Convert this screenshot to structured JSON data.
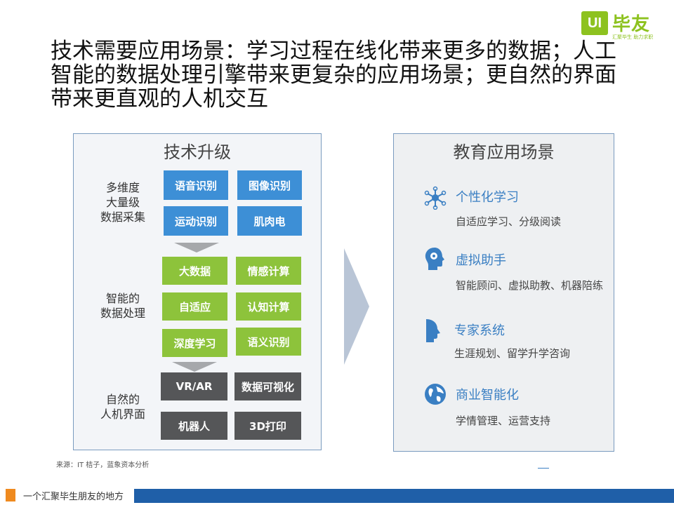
{
  "logo": {
    "mark": "UI",
    "brand": "毕友",
    "slogan": "汇聚毕生  助力求职"
  },
  "title": "技术需要应用场景：学习过程在线化带来更多的数据；人工智能的数据处理引擎带来更复杂的应用场景；更自然的界面带来更直观的人机交互",
  "left_panel": {
    "title": "技术升级",
    "groups": [
      {
        "label": "多维度\n大量级\n数据采集",
        "items": [
          "语音识别",
          "图像识别",
          "运动识别",
          "肌肉电"
        ]
      },
      {
        "label": "智能的\n数据处理",
        "items": [
          "大数据",
          "情感计算",
          "自适应",
          "认知计算",
          "深度学习",
          "语义识别"
        ]
      },
      {
        "label": "自然的\n人机界面",
        "items": [
          "VR/AR",
          "数据可视化",
          "机器人",
          "3D打印"
        ]
      }
    ]
  },
  "right_panel": {
    "title": "教育应用场景",
    "items": [
      {
        "name": "个性化学习",
        "desc": "自适应学习、分级阅读",
        "icon": "network-nodes-icon"
      },
      {
        "name": "虚拟助手",
        "desc": "智能顾问、虚拟助教、机器陪练",
        "icon": "head-gears-icon"
      },
      {
        "name": "专家系统",
        "desc": "生涯规划、留学升学咨询",
        "icon": "head-profile-icon"
      },
      {
        "name": "商业智能化",
        "desc": "学情管理、运营支持",
        "icon": "globe-icon"
      }
    ]
  },
  "source": "来源：IT 桔子，蓝象资本分析",
  "footer": "一个汇聚毕生朋友的地方",
  "colors": {
    "blue": "#3d8fd6",
    "green": "#8dc33b",
    "gray": "#555658",
    "accent": "#1f5fa8",
    "orange": "#ef8a1f"
  }
}
